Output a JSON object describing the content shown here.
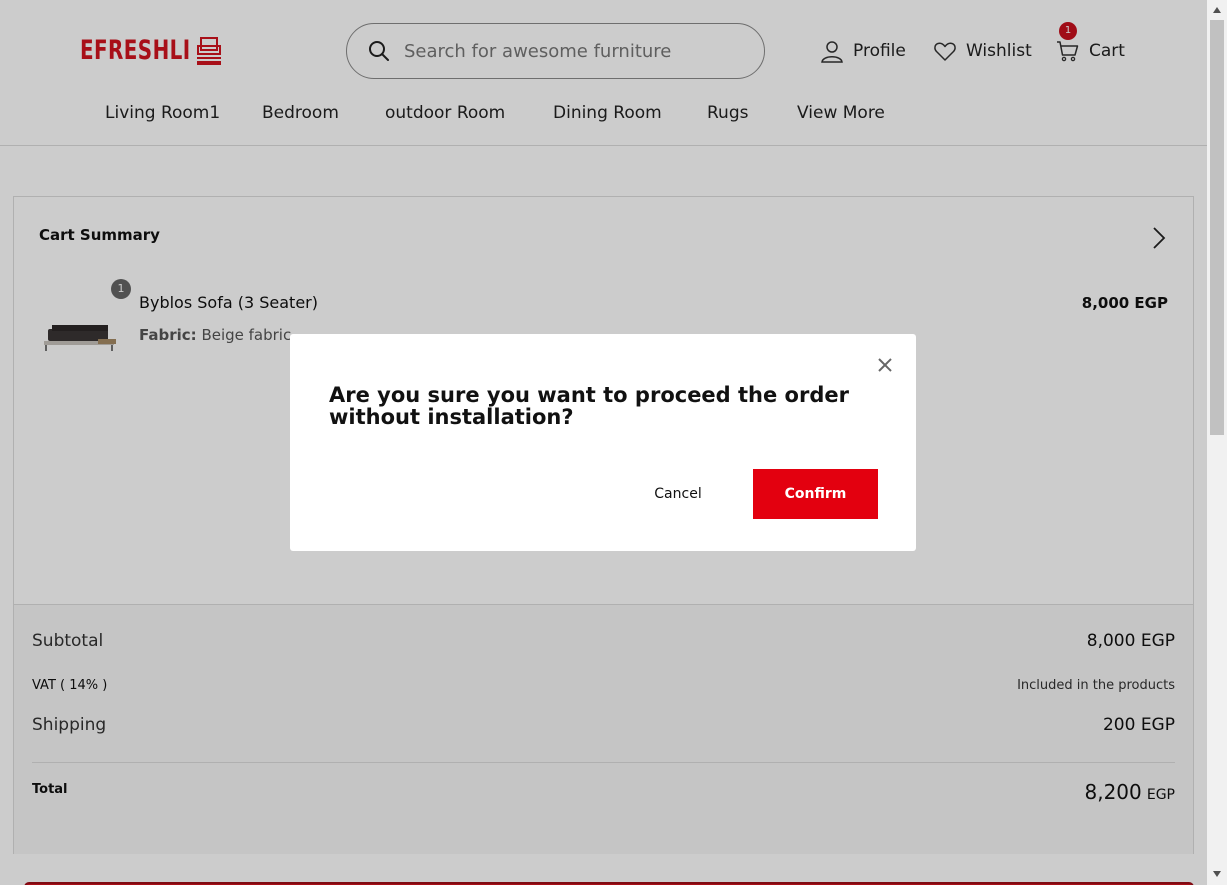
{
  "brand": {
    "logo_text": "EFRESHLI",
    "accent": "#d3131e"
  },
  "search": {
    "placeholder": "Search for awesome furniture"
  },
  "header": {
    "profile_label": "Profile",
    "wishlist_label": "Wishlist",
    "cart_label": "Cart",
    "cart_count": "1"
  },
  "nav": {
    "items": [
      "Living Room1",
      "Bedroom",
      "outdoor Room",
      "Dining Room",
      "Rugs",
      "View More"
    ]
  },
  "cart_summary": {
    "title": "Cart Summary",
    "item": {
      "quantity": "1",
      "name": "Byblos Sofa (3 Seater)",
      "attr_label": "Fabric:",
      "attr_value": "Beige fabric",
      "price": "8,000 EGP"
    },
    "subtotal_label": "Subtotal",
    "subtotal_value": "8,000 EGP",
    "vat_label": "VAT ( 14% )",
    "vat_value": "Included in the products",
    "shipping_label": "Shipping",
    "shipping_value": "200 EGP",
    "total_label": "Total",
    "total_amount": "8,200",
    "total_currency": "EGP"
  },
  "modal": {
    "message": "Are you sure you want to proceed the order without installation?",
    "cancel_label": "Cancel",
    "confirm_label": "Confirm",
    "confirm_color": "#e3000f"
  }
}
